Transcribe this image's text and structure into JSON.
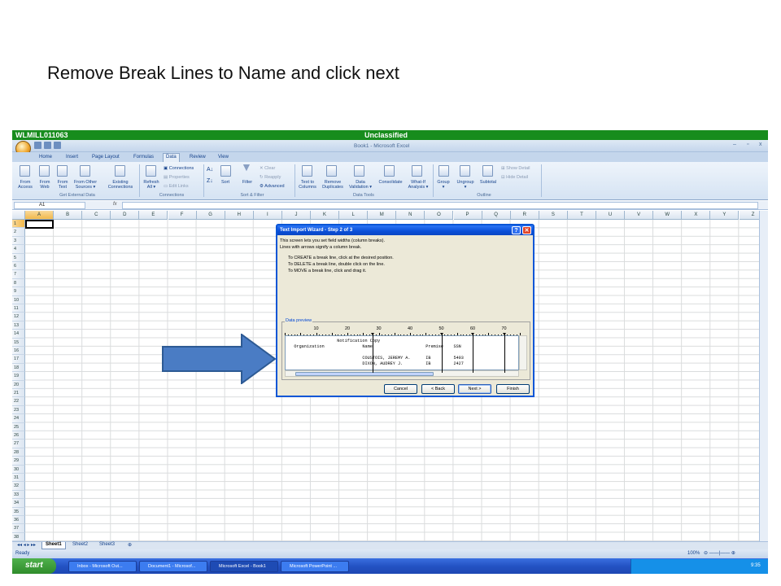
{
  "slide": {
    "instruction": "Remove Break Lines to Name and click next"
  },
  "classification": {
    "host": "WLMILL011063",
    "label": "Unclassified",
    "color": "#178c1d"
  },
  "window": {
    "title": "Book1 - Microsoft Excel"
  },
  "tabs": [
    "Home",
    "Insert",
    "Page Layout",
    "Formulas",
    "Data",
    "Review",
    "View"
  ],
  "active_tab": "Data",
  "ribbon": {
    "get_external": {
      "label": "Get External Data",
      "buttons": [
        "From\nAccess",
        "From\nWeb",
        "From\nText",
        "From Other\nSources ▾",
        "Existing\nConnections"
      ]
    },
    "connections": {
      "label": "Connections",
      "refresh": "Refresh\nAll ▾",
      "items": [
        "Connections",
        "Properties",
        "Edit Links"
      ]
    },
    "sort_filter": {
      "label": "Sort & Filter",
      "sort": "Sort",
      "filter": "Filter",
      "items": [
        "Clear",
        "Reapply",
        "Advanced"
      ]
    },
    "data_tools": {
      "label": "Data Tools",
      "buttons": [
        "Text to\nColumns",
        "Remove\nDuplicates",
        "Data\nValidation ▾",
        "Consolidate",
        "What-If\nAnalysis ▾"
      ]
    },
    "outline": {
      "label": "Outline",
      "buttons": [
        "Group\n▾",
        "Ungroup\n▾",
        "Subtotal"
      ],
      "items": [
        "Show Detail",
        "Hide Detail"
      ]
    }
  },
  "formula_bar": {
    "name_box": "A1",
    "fx": "fx"
  },
  "columns": [
    "A",
    "B",
    "C",
    "D",
    "E",
    "F",
    "G",
    "H",
    "I",
    "J",
    "K",
    "L",
    "M",
    "N",
    "O",
    "P",
    "Q",
    "R",
    "S",
    "T",
    "U",
    "V",
    "W",
    "X",
    "Y",
    "Z"
  ],
  "rows": [
    "1",
    "2",
    "3",
    "4",
    "5",
    "6",
    "7",
    "8",
    "9",
    "10",
    "11",
    "12",
    "13",
    "14",
    "15",
    "16",
    "17",
    "18",
    "19",
    "20",
    "21",
    "22",
    "23",
    "24",
    "25",
    "26",
    "27",
    "28",
    "29",
    "30",
    "31",
    "32",
    "33",
    "34",
    "35",
    "36",
    "37",
    "38"
  ],
  "sheets": [
    "Sheet1",
    "Sheet2",
    "Sheet3"
  ],
  "status": {
    "left": "Ready",
    "zoom": "100%"
  },
  "taskbar": {
    "start": "start",
    "tasks": [
      "Inbox - Microsoft Out...",
      "Document1 - Microsof...",
      "Microsoft Excel - Book1",
      "Microsoft PowerPoint ..."
    ],
    "clock": "9:35"
  },
  "dialog": {
    "title": "Text Import Wizard - Step 2 of 3",
    "intro1": "This screen lets you set field widths (column breaks).",
    "intro2": "Lines with arrows signify a column break.",
    "tip1": "To CREATE a break line, click at the desired position.",
    "tip2": "To DELETE a break line, double click on the line.",
    "tip3": "To MOVE a break line, click and drag it.",
    "preview_label": "Data preview",
    "ruler": [
      "10",
      "20",
      "30",
      "40",
      "50",
      "60",
      "70"
    ],
    "preview_lines": [
      "                    Notification Copy",
      "   Organization               Name                     Premise    SSN",
      "",
      "                              COUSTOIS, JEREMY A.      IB         5403",
      "                              DIXON, AUDREY J.         IB         2427"
    ],
    "buttons": {
      "cancel": "Cancel",
      "back": "< Back",
      "next": "Next >",
      "finish": "Finish"
    }
  }
}
